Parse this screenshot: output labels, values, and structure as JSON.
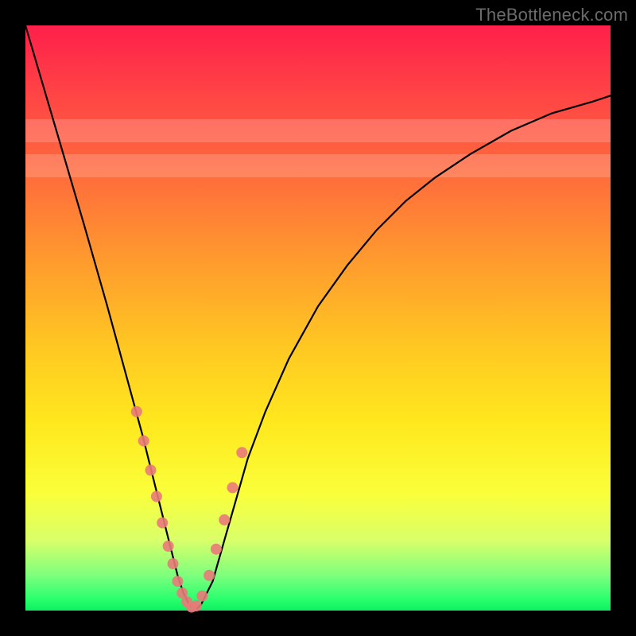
{
  "watermark": "TheBottleneck.com",
  "chart_data": {
    "type": "line",
    "title": "",
    "xlabel": "",
    "ylabel": "",
    "xlim": [
      0,
      100
    ],
    "ylim": [
      0,
      100
    ],
    "series": [
      {
        "name": "bottleneck-curve",
        "x": [
          0,
          5,
          10,
          14,
          17,
          20,
          22,
          24,
          25,
          26,
          27,
          28,
          29,
          30,
          32,
          34,
          36,
          38,
          41,
          45,
          50,
          55,
          60,
          65,
          70,
          76,
          83,
          90,
          97,
          100
        ],
        "values": [
          100,
          83,
          66,
          52,
          41,
          30,
          22,
          14,
          10,
          6,
          3,
          1,
          0,
          1,
          5,
          12,
          19,
          26,
          34,
          43,
          52,
          59,
          65,
          70,
          74,
          78,
          82,
          85,
          87,
          88
        ]
      }
    ],
    "markers": {
      "name": "highlight-dots",
      "color": "#e97a7a",
      "x": [
        19.0,
        20.2,
        21.4,
        22.4,
        23.4,
        24.4,
        25.2,
        26.0,
        26.8,
        27.6,
        28.4,
        29.2,
        30.2,
        31.4,
        32.6,
        34.0,
        35.4,
        37.0
      ],
      "values": [
        34.0,
        29.0,
        24.0,
        19.5,
        15.0,
        11.0,
        8.0,
        5.0,
        3.0,
        1.5,
        0.6,
        0.8,
        2.5,
        6.0,
        10.5,
        15.5,
        21.0,
        27.0
      ]
    },
    "pale_bands_y": [
      [
        74,
        78
      ],
      [
        80,
        84
      ]
    ]
  }
}
